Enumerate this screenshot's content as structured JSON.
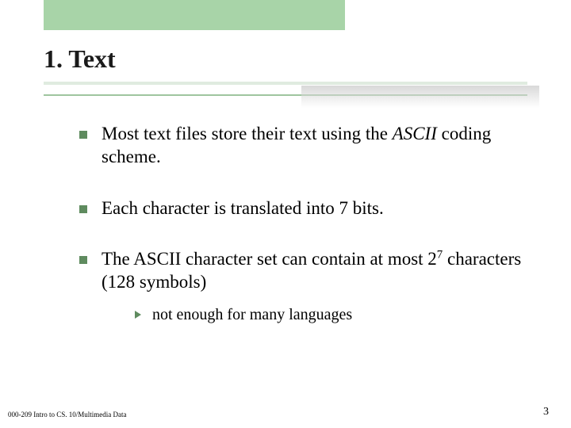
{
  "accent_color": "#a8d4a8",
  "bullet_color": "#5f8b5f",
  "heading": "1.  Text",
  "bullets": {
    "b1_pre": "Most text files store their text using the ",
    "b1_em": "ASCII",
    "b1_post": " coding scheme.",
    "b2": "Each character is translated into 7 bits.",
    "b3_pre": "The ASCII character set can contain at most 2",
    "b3_sup": "7",
    "b3_post": " characters (128 symbols)",
    "sub1": "not enough for many languages"
  },
  "footer": {
    "left": "000-209 Intro to CS. 10/Multimedia Data",
    "right": "3"
  }
}
